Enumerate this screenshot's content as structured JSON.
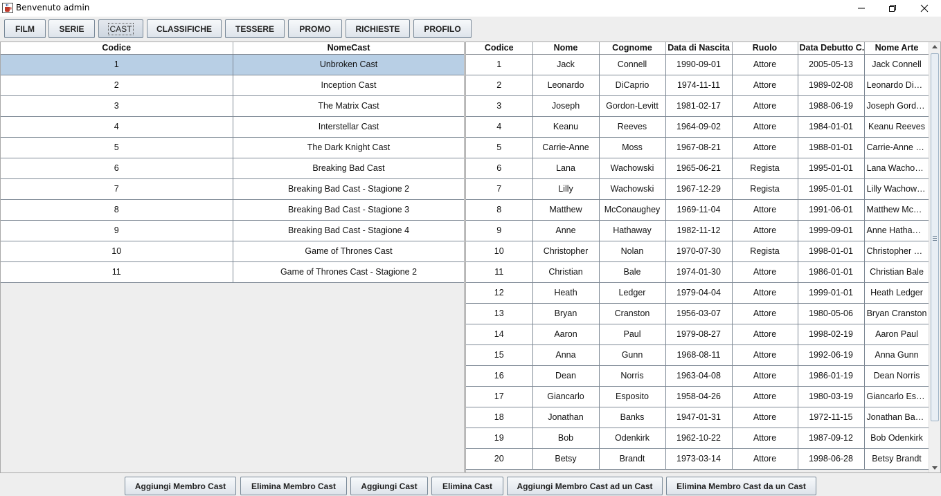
{
  "window": {
    "title": "Benvenuto admin",
    "icon": "java-coffee-icon"
  },
  "toolbar": {
    "buttons": [
      {
        "label": "FILM"
      },
      {
        "label": "SERIE"
      },
      {
        "label": "CAST"
      },
      {
        "label": "CLASSIFICHE"
      },
      {
        "label": "TESSERE"
      },
      {
        "label": "PROMO"
      },
      {
        "label": "RICHIESTE"
      },
      {
        "label": "PROFILO"
      }
    ],
    "active": "CAST"
  },
  "cast_table": {
    "headers": [
      "Codice",
      "NomeCast"
    ],
    "selected_row": 0,
    "rows": [
      [
        "1",
        "Unbroken Cast"
      ],
      [
        "2",
        "Inception Cast"
      ],
      [
        "3",
        "The Matrix Cast"
      ],
      [
        "4",
        "Interstellar Cast"
      ],
      [
        "5",
        "The Dark Knight Cast"
      ],
      [
        "6",
        "Breaking Bad Cast"
      ],
      [
        "7",
        "Breaking Bad Cast - Stagione 2"
      ],
      [
        "8",
        "Breaking Bad Cast - Stagione 3"
      ],
      [
        "9",
        "Breaking Bad Cast - Stagione 4"
      ],
      [
        "10",
        "Game of Thrones Cast"
      ],
      [
        "11",
        "Game of Thrones Cast - Stagione 2"
      ]
    ]
  },
  "members_table": {
    "headers": [
      "Codice",
      "Nome",
      "Cognome",
      "Data di Nascita",
      "Ruolo",
      "Data Debutto C...",
      "Nome Arte"
    ],
    "rows": [
      [
        "1",
        "Jack",
        "Connell",
        "1990-09-01",
        "Attore",
        "2005-05-13",
        "Jack Connell"
      ],
      [
        "2",
        "Leonardo",
        "DiCaprio",
        "1974-11-11",
        "Attore",
        "1989-02-08",
        "Leonardo DiC..."
      ],
      [
        "3",
        "Joseph",
        "Gordon-Levitt",
        "1981-02-17",
        "Attore",
        "1988-06-19",
        "Joseph Gordo..."
      ],
      [
        "4",
        "Keanu",
        "Reeves",
        "1964-09-02",
        "Attore",
        "1984-01-01",
        "Keanu Reeves"
      ],
      [
        "5",
        "Carrie-Anne",
        "Moss",
        "1967-08-21",
        "Attore",
        "1988-01-01",
        "Carrie-Anne M..."
      ],
      [
        "6",
        "Lana",
        "Wachowski",
        "1965-06-21",
        "Regista",
        "1995-01-01",
        "Lana Wachow..."
      ],
      [
        "7",
        "Lilly",
        "Wachowski",
        "1967-12-29",
        "Regista",
        "1995-01-01",
        "Lilly Wachowski"
      ],
      [
        "8",
        "Matthew",
        "McConaughey",
        "1969-11-04",
        "Attore",
        "1991-06-01",
        "Matthew McCo..."
      ],
      [
        "9",
        "Anne",
        "Hathaway",
        "1982-11-12",
        "Attore",
        "1999-09-01",
        "Anne Hathaway"
      ],
      [
        "10",
        "Christopher",
        "Nolan",
        "1970-07-30",
        "Regista",
        "1998-01-01",
        "Christopher N..."
      ],
      [
        "11",
        "Christian",
        "Bale",
        "1974-01-30",
        "Attore",
        "1986-01-01",
        "Christian Bale"
      ],
      [
        "12",
        "Heath",
        "Ledger",
        "1979-04-04",
        "Attore",
        "1999-01-01",
        "Heath Ledger"
      ],
      [
        "13",
        "Bryan",
        "Cranston",
        "1956-03-07",
        "Attore",
        "1980-05-06",
        "Bryan Cranston"
      ],
      [
        "14",
        "Aaron",
        "Paul",
        "1979-08-27",
        "Attore",
        "1998-02-19",
        "Aaron Paul"
      ],
      [
        "15",
        "Anna",
        "Gunn",
        "1968-08-11",
        "Attore",
        "1992-06-19",
        "Anna Gunn"
      ],
      [
        "16",
        "Dean",
        "Norris",
        "1963-04-08",
        "Attore",
        "1986-01-19",
        "Dean Norris"
      ],
      [
        "17",
        "Giancarlo",
        "Esposito",
        "1958-04-26",
        "Attore",
        "1980-03-19",
        "Giancarlo Esp..."
      ],
      [
        "18",
        "Jonathan",
        "Banks",
        "1947-01-31",
        "Attore",
        "1972-11-15",
        "Jonathan Banks"
      ],
      [
        "19",
        "Bob",
        "Odenkirk",
        "1962-10-22",
        "Attore",
        "1987-09-12",
        "Bob Odenkirk"
      ],
      [
        "20",
        "Betsy",
        "Brandt",
        "1973-03-14",
        "Attore",
        "1998-06-28",
        "Betsy Brandt"
      ]
    ]
  },
  "actions": {
    "buttons": [
      {
        "label": "Aggiungi Membro Cast"
      },
      {
        "label": "Elimina Membro Cast"
      },
      {
        "label": "Aggiungi Cast"
      },
      {
        "label": "Elimina Cast"
      },
      {
        "label": "Aggiungi Membro Cast ad un Cast"
      },
      {
        "label": "Elimina Membro Cast da un Cast"
      }
    ]
  }
}
